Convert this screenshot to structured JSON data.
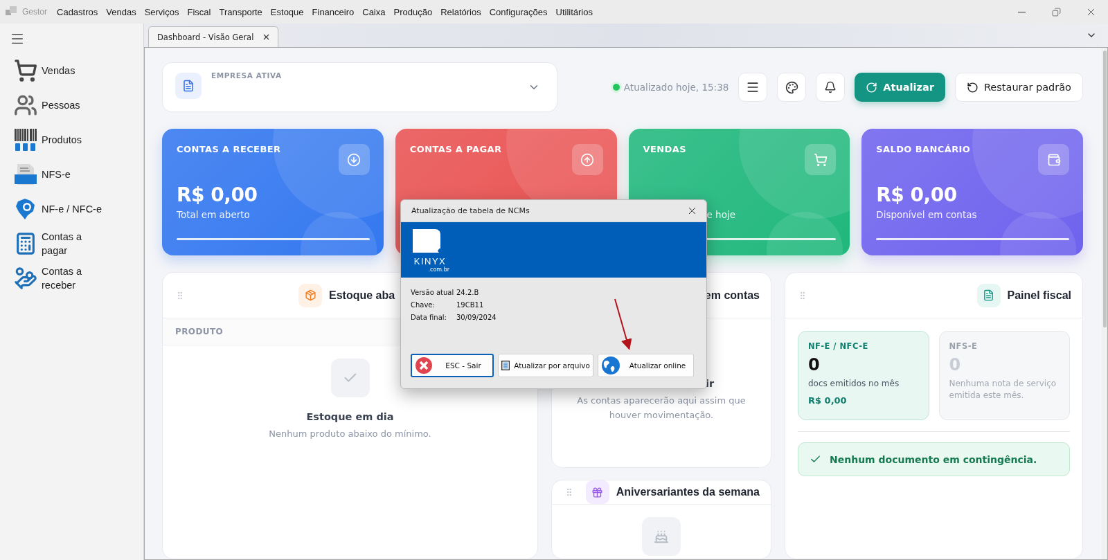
{
  "menu_bar": {
    "app_name": "Gestor",
    "items": [
      "Cadastros",
      "Vendas",
      "Serviços",
      "Fiscal",
      "Transporte",
      "Estoque",
      "Financeiro",
      "Caixa",
      "Produção",
      "Relatórios",
      "Configurações",
      "Utilitários"
    ]
  },
  "sidebar": {
    "items": [
      {
        "label": "Vendas",
        "kind": "cart"
      },
      {
        "label": "Pessoas",
        "kind": "people"
      },
      {
        "label": "Produtos",
        "kind": "barcode"
      },
      {
        "label": "NFS-e",
        "kind": "nfse"
      },
      {
        "label": "NF-e / NFC-e",
        "kind": "nfe"
      },
      {
        "label": "Contas a pagar",
        "kind": "pay"
      },
      {
        "label": "Contas a receber",
        "kind": "receive"
      }
    ]
  },
  "tabs": [
    {
      "label": "Dashboard - Visão Geral",
      "selected": true
    }
  ],
  "header": {
    "company_label": "EMPRESA ATIVA",
    "status": "Atualizado hoje, 15:38",
    "refresh_button": "Atualizar",
    "restore_button": "Restaurar padrão"
  },
  "summary_cards": [
    {
      "title": "CONTAS A RECEBER",
      "value": "R$ 0,00",
      "subtitle": "Total em aberto",
      "color": "#3478f0",
      "kind": "down"
    },
    {
      "title": "CONTAS A PAGAR",
      "color": "#ea5252",
      "kind": "up"
    },
    {
      "title": "VENDAS",
      "subtitle": "e hoje",
      "color": "#20b87c",
      "kind": "cart"
    },
    {
      "title": "SALDO BANCÁRIO",
      "value": "R$ 0,00",
      "subtitle": "Disponível em contas",
      "color": "#6f63ee",
      "kind": "wallet"
    }
  ],
  "stock_panel": {
    "title": "Estoque aba",
    "column": "PRODUTO",
    "empty_title": "Estoque em dia",
    "empty_text": "Nenhum produto abaixo do mínimo."
  },
  "accounts_panel": {
    "title": "em contas",
    "empty_title": "ir",
    "empty_text": "As contas aparecerão aqui assim que houver movimentação."
  },
  "birthdays_panel": {
    "title": "Aniversariantes da semana"
  },
  "fiscal_panel": {
    "title": "Painel fiscal",
    "boxes": [
      {
        "title": "NF-E / NFC-E",
        "value": "0",
        "caption": "docs emitidos no mês",
        "amount": "R$ 0,00",
        "disabled": false
      },
      {
        "title": "NFS-E",
        "value": "0",
        "caption": "Nenhuma nota de serviço emitida este mês.",
        "disabled": true
      }
    ],
    "notice": "Nenhum documento em contingência."
  },
  "dialog": {
    "title": "Atualização de tabela de NCMs",
    "logo_text": "KINYX",
    "logo_domain": ".com.br",
    "rows": [
      {
        "label": "Versão atual",
        "value": "24.2.B"
      },
      {
        "label": "Chave:",
        "value": "19CB11"
      },
      {
        "label": "Data final:",
        "value": "30/09/2024"
      }
    ],
    "buttons": [
      {
        "label": "ESC - Sair",
        "kind": "exit",
        "selected": true
      },
      {
        "label": "Atualizar por arquivo",
        "kind": "file",
        "selected": false
      },
      {
        "label": "Atualizar online",
        "kind": "online",
        "selected": false
      }
    ]
  }
}
